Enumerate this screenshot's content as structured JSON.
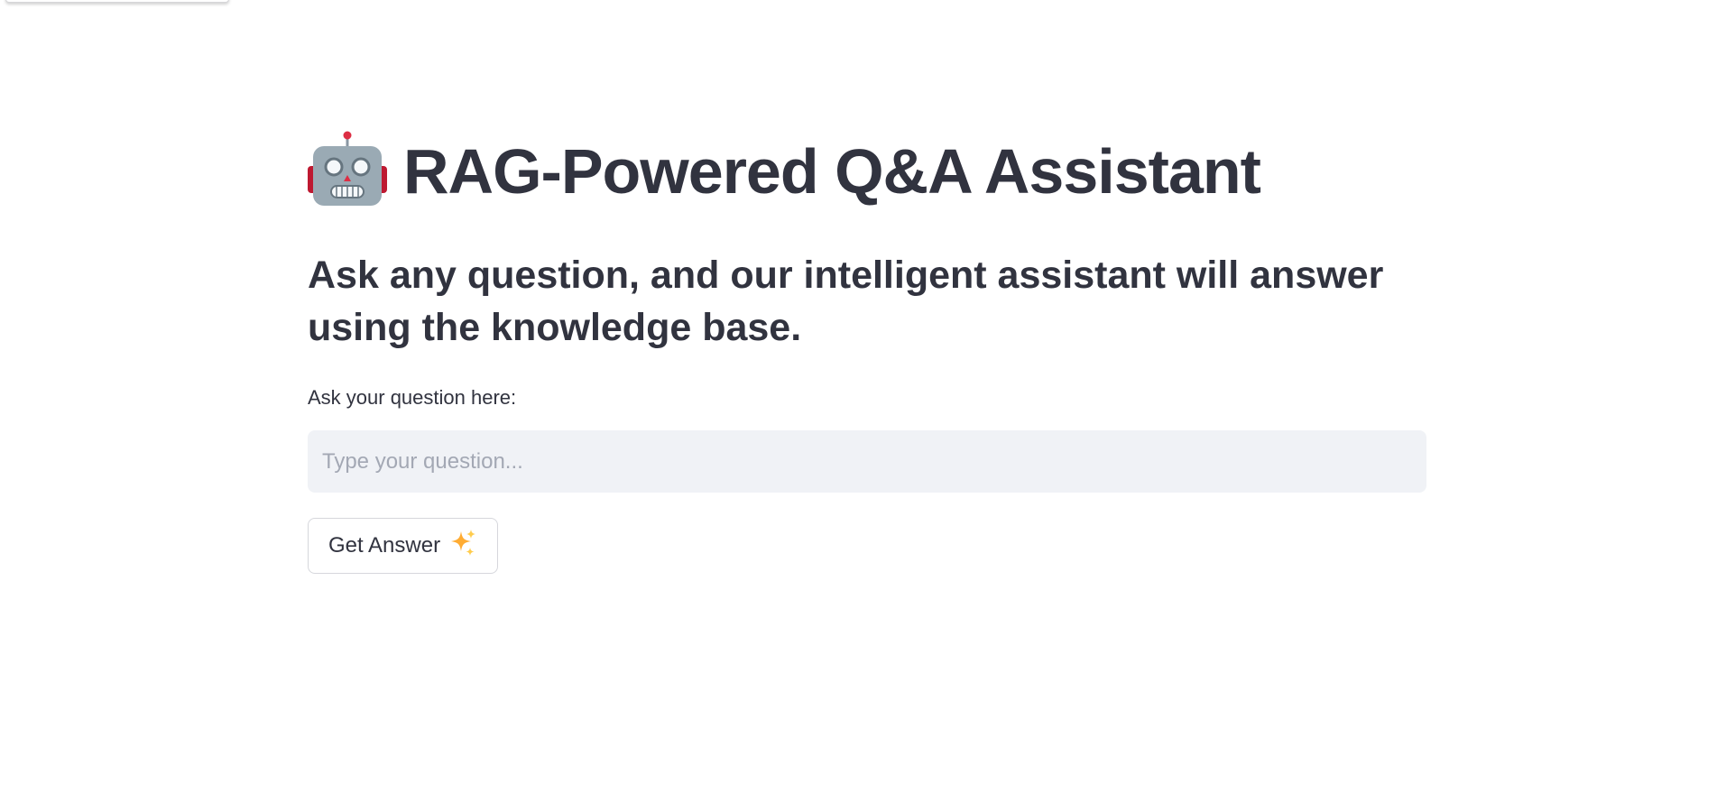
{
  "header": {
    "title": "RAG-Powered Q&A Assistant",
    "icon": "robot-icon"
  },
  "intro": {
    "subtitle": "Ask any question, and our intelligent assistant will answer using the knowledge base."
  },
  "question_form": {
    "label": "Ask your question here:",
    "value": "",
    "placeholder": "Type your question...",
    "submit_label": "Get Answer",
    "submit_icon": "sparkles-icon"
  },
  "colors": {
    "text": "#31333f",
    "input_background": "#f0f2f6",
    "placeholder": "#a3a8b4",
    "button_border": "#d6d7dc"
  }
}
